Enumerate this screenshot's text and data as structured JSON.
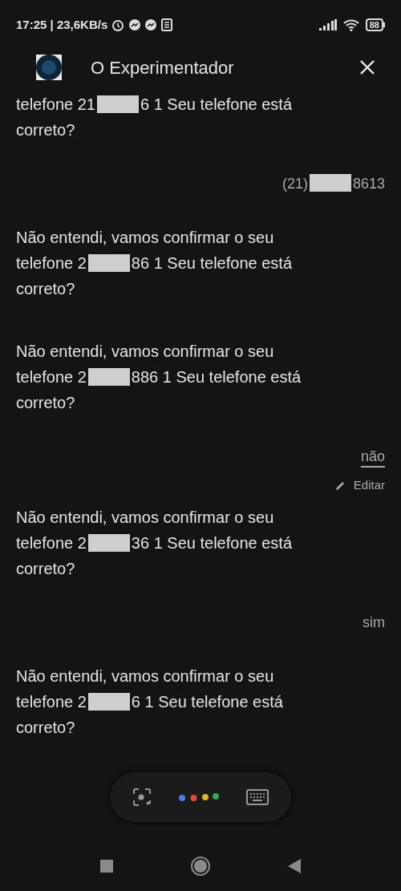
{
  "status_bar": {
    "time": "17:25 | 23,6KB/s",
    "battery": "88"
  },
  "header": {
    "title": "O Experimentador"
  },
  "messages": [
    {
      "kind": "bot",
      "before": "telefone 21",
      "after": "6 1 Seu telefone está correto?"
    },
    {
      "kind": "user",
      "before": "(21)",
      "after": "8613"
    },
    {
      "kind": "bot",
      "before": "Não entendi, vamos confirmar o seu telefone 2",
      "after": "86 1 Seu telefone está correto?"
    },
    {
      "kind": "bot",
      "before": "Não entendi, vamos confirmar o seu telefone 2",
      "after": "886 1 Seu telefone está correto?"
    },
    {
      "kind": "user",
      "text": "não",
      "edit": "Editar",
      "underlined": true
    },
    {
      "kind": "bot",
      "before": "Não entendi, vamos confirmar o seu telefone 2",
      "after": "36 1 Seu telefone está correto?"
    },
    {
      "kind": "user",
      "text": "sim",
      "underlined": false
    },
    {
      "kind": "bot",
      "before": "Não entendi, vamos confirmar o seu telefone 2",
      "after": "6 1 Seu telefone está correto?"
    }
  ]
}
